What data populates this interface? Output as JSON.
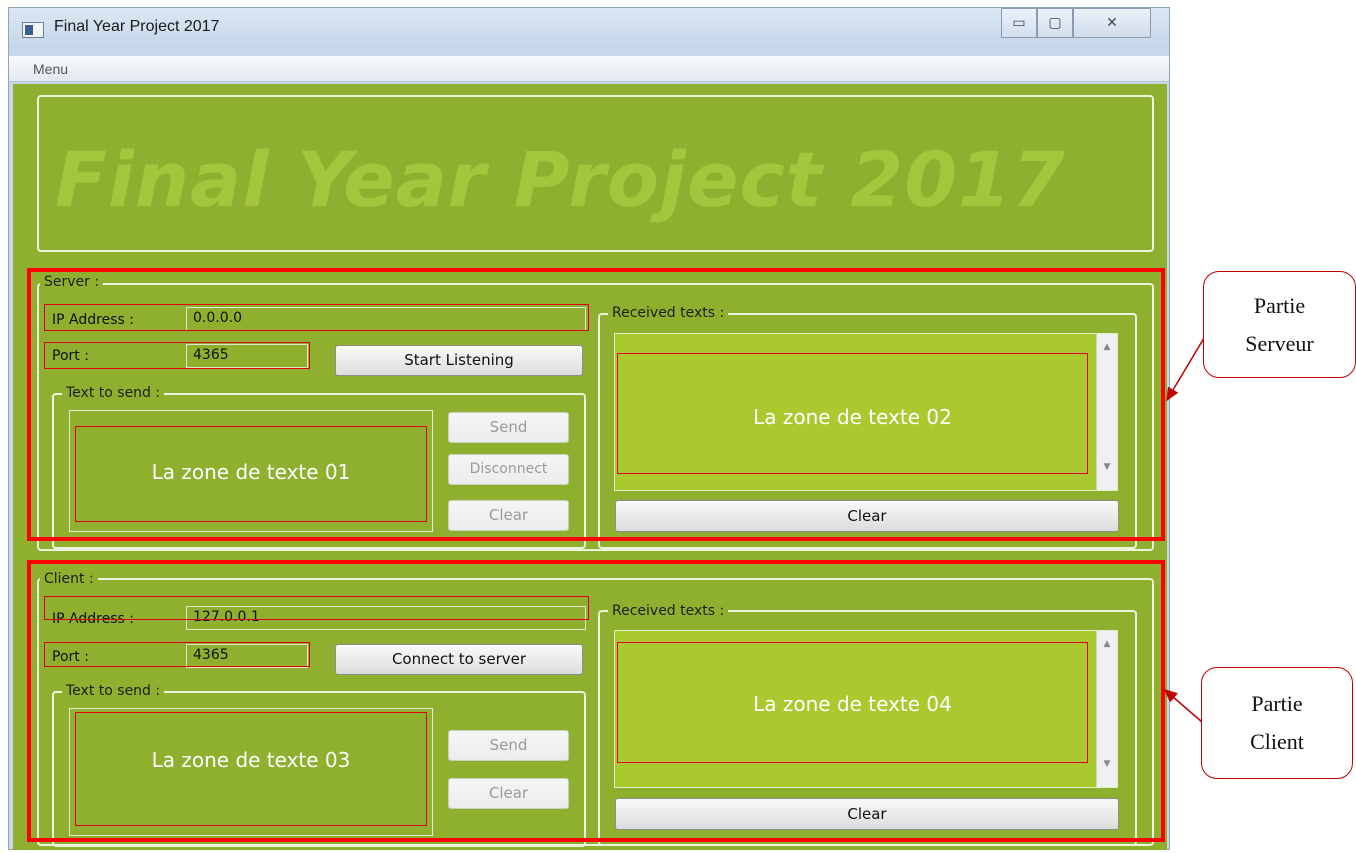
{
  "window": {
    "title": "Final Year Project 2017",
    "minimize_glyph": "▭",
    "maximize_glyph": "▢",
    "close_glyph": "✕"
  },
  "menu": {
    "items": [
      "Menu"
    ]
  },
  "banner": {
    "text": "Final Year Project 2017"
  },
  "server": {
    "legend": "Server :",
    "ip_label": "IP Address :",
    "ip_value": "0.0.0.0",
    "port_label": "Port :",
    "port_value": "4365",
    "action_button": "Start Listening",
    "send_group_legend": "Text to send :",
    "send_area_label": "La zone de texte 01",
    "send_button": "Send",
    "disconnect_button": "Disconnect",
    "clear_button": "Clear",
    "received_legend": "Received texts :",
    "received_area_label": "La zone de texte 02",
    "received_clear_button": "Clear"
  },
  "client": {
    "legend": "Client :",
    "ip_label": "IP Address :",
    "ip_value": "127.0.0.1",
    "port_label": "Port :",
    "port_value": "4365",
    "action_button": "Connect to server",
    "send_group_legend": "Text to send :",
    "send_area_label": "La zone de texte 03",
    "send_button": "Send",
    "clear_button": "Clear",
    "received_legend": "Received texts :",
    "received_area_label": "La zone de texte 04",
    "received_clear_button": "Clear"
  },
  "annotations": {
    "server_callout_line1": "Partie",
    "server_callout_line2": "Serveur",
    "client_callout_line1": "Partie",
    "client_callout_line2": "Client"
  },
  "colors": {
    "window_background": "#8faf2f",
    "banner_text": "#a3c63d",
    "received_area": "#aac92f",
    "annotation_red": "#ff0000"
  }
}
